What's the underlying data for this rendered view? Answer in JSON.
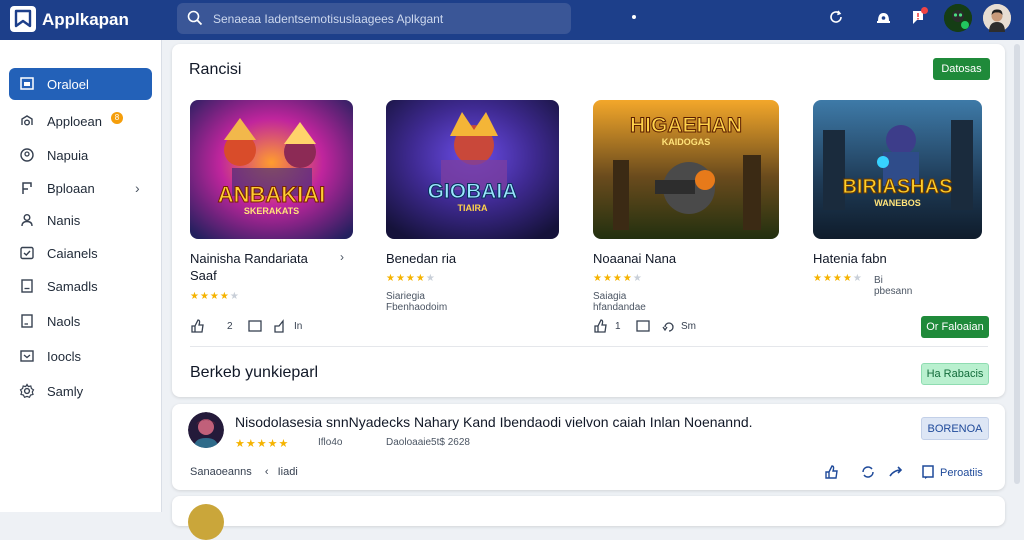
{
  "app": {
    "title": "Applkapan"
  },
  "search": {
    "placeholder": "Senaeaa Iadentsemotisuslaagees Aplkgant"
  },
  "sidebar": {
    "items": [
      {
        "label": "Oraloel",
        "icon": "dashboard-icon",
        "active": true
      },
      {
        "label": "Apploean",
        "icon": "apps-icon",
        "badge": "8"
      },
      {
        "label": "Napuia",
        "icon": "location-icon"
      },
      {
        "label": "Bploaan",
        "icon": "bookmark-icon",
        "chevron": true
      },
      {
        "label": "Nanis",
        "icon": "user-icon"
      },
      {
        "label": "Caianels",
        "icon": "check-square-icon"
      },
      {
        "label": "Samadls",
        "icon": "document-icon"
      },
      {
        "label": "Naols",
        "icon": "edit-icon"
      },
      {
        "label": "Ioocls",
        "icon": "mail-icon"
      },
      {
        "label": "Samly",
        "icon": "settings-icon"
      }
    ]
  },
  "featured": {
    "title": "Rancisi",
    "top_button": "Datosas",
    "cards": [
      {
        "name": "Nainisha Randariata\nSaaf",
        "art_text": "ANBAKIAI",
        "art_sub": "SKERAKATS",
        "rating": 4,
        "developer": "",
        "actions": [
          "2"
        ],
        "action_labels": [
          "In"
        ],
        "has_chevron": true,
        "art_colors": [
          "#2a2370",
          "#ff7a1a",
          "#c0259d"
        ]
      },
      {
        "name": "Benedan ria",
        "art_text": "GIOBAIA",
        "art_sub": "TIAIRA",
        "rating": 4,
        "developer": "Siariegia Fbenhaodoim",
        "actions": [],
        "art_colors": [
          "#1a1847",
          "#3b82f6",
          "#a855f7"
        ]
      },
      {
        "name": "Noaanai Nana",
        "art_text": "HIGAEHAN",
        "art_sub": "KAIDOGAS",
        "rating": 4,
        "developer": "Saiagia hfandandae",
        "actions": [
          "1"
        ],
        "action_labels": [
          "Sm"
        ],
        "art_colors": [
          "#2c3d15",
          "#e9a30a",
          "#7d4b1a"
        ]
      },
      {
        "name": "Hatenia fabn",
        "art_text": "BIRIASHAS",
        "art_sub": "WANEBOS",
        "rating": 4,
        "developer": "Bi pbesann",
        "actions": [],
        "art_colors": [
          "#13233c",
          "#2e6a8f",
          "#ffc21a"
        ]
      }
    ],
    "card_button": "Or Faloaian",
    "sub_title": "Berkeb yunkieparl",
    "sub_button": "Ha Rabacis"
  },
  "review": {
    "text": "Nisodolasesia snnNyadecks Nahary Kand Ibendaodi vielvon caiah Inlan Noenannd.",
    "rating": 5,
    "count": "Iflo4o",
    "date": "Daoloaaie5t$ 2628",
    "follow_button": "BORENOA",
    "footer_left": "Sanaoeanns",
    "footer_mid": "Iiadi",
    "reply_label": "Peroatiis"
  },
  "colors": {
    "topbar": "#1d3f8a",
    "accent_blue": "#2361b8",
    "accent_green": "#1f8a3a",
    "star": "#f5b301"
  }
}
